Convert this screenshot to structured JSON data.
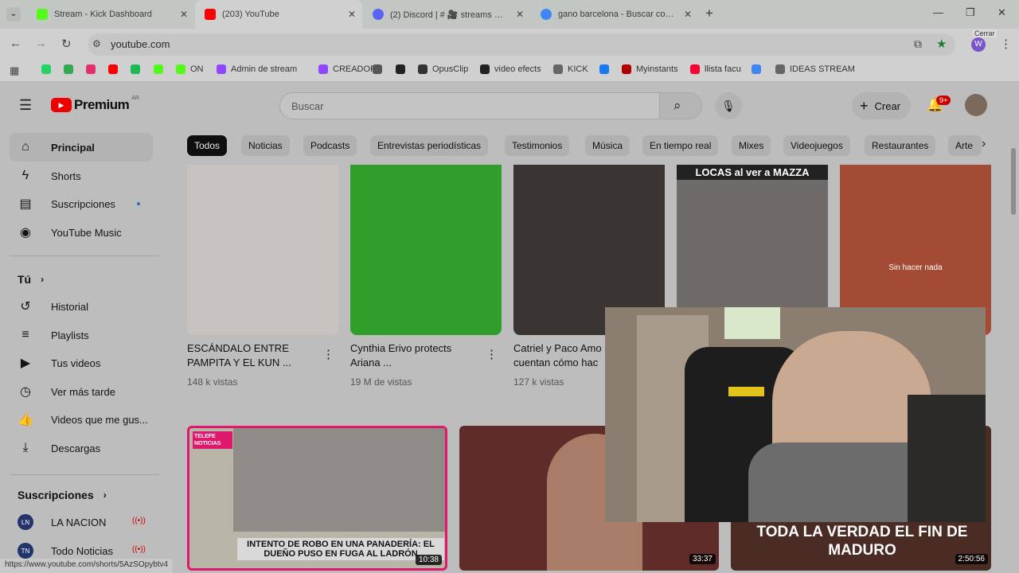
{
  "tabs": [
    {
      "title": "Stream - Kick Dashboard",
      "color": "#53fc18"
    },
    {
      "title": "(203) YouTube",
      "color": "#ff0000"
    },
    {
      "title": "(2) Discord | # 🎥 streams 🎥 | L",
      "color": "#5865f2"
    },
    {
      "title": "gano barcelona - Buscar con G",
      "color": "#4285f4"
    }
  ],
  "address": {
    "url": "youtube.com",
    "tooltip": "Cerrar"
  },
  "bookmarks": [
    {
      "label": "",
      "color": "#25d366"
    },
    {
      "label": "",
      "color": "#34a853"
    },
    {
      "label": "",
      "color": "#e1306c"
    },
    {
      "label": "",
      "color": "#ff0000"
    },
    {
      "label": "",
      "color": "#1db954"
    },
    {
      "label": "",
      "color": "#53fc18"
    },
    {
      "label": "ON",
      "color": "#53fc18"
    },
    {
      "label": "Admin de stream",
      "color": "#9146ff"
    },
    {
      "label": "CREADOR",
      "color": "#9146ff"
    },
    {
      "label": "",
      "color": "#555555"
    },
    {
      "label": "",
      "color": "#222222"
    },
    {
      "label": "OpusClip",
      "color": "#333333"
    },
    {
      "label": "video efects",
      "color": "#222222"
    },
    {
      "label": "KICK",
      "color": "#666666"
    },
    {
      "label": "",
      "color": "#1877f2"
    },
    {
      "label": "Myinstants",
      "color": "#b00000"
    },
    {
      "label": "llista facu",
      "color": "#ff0033"
    },
    {
      "label": "",
      "color": "#4285f4"
    },
    {
      "label": "IDEAS STREAM",
      "color": "#666666"
    }
  ],
  "header": {
    "logo": "Premium",
    "country": "AR",
    "search_placeholder": "Buscar",
    "create_label": "Crear",
    "notif_count": "9+"
  },
  "sidebar": {
    "main": [
      {
        "label": "Principal",
        "icon": "home-icon"
      },
      {
        "label": "Shorts",
        "icon": "shorts-icon"
      },
      {
        "label": "Suscripciones",
        "icon": "subscriptions-icon"
      },
      {
        "label": "YouTube Music",
        "icon": "music-icon"
      }
    ],
    "you_header": "Tú",
    "you": [
      {
        "label": "Historial",
        "icon": "history-icon"
      },
      {
        "label": "Playlists",
        "icon": "playlists-icon"
      },
      {
        "label": "Tus videos",
        "icon": "your-videos-icon"
      },
      {
        "label": "Ver más tarde",
        "icon": "watch-later-icon"
      },
      {
        "label": "Videos que me gus...",
        "icon": "liked-icon"
      },
      {
        "label": "Descargas",
        "icon": "downloads-icon"
      }
    ],
    "subs_header": "Suscripciones",
    "subs": [
      {
        "label": "LA NACION",
        "avatar": "LN"
      },
      {
        "label": "Todo Noticias",
        "avatar": "TN"
      }
    ]
  },
  "chips": [
    "Todos",
    "Noticias",
    "Podcasts",
    "Entrevistas periodísticas",
    "Testimonios",
    "Música",
    "En tiempo real",
    "Mixes",
    "Videojuegos",
    "Restaurantes",
    "Arte"
  ],
  "shorts": [
    {
      "title": "ESCÁNDALO ENTRE PAMPITA Y EL KUN ...",
      "views": "148 k vistas",
      "bg": "#c8c3c0"
    },
    {
      "title": "Cynthia Erivo protects Ariana ...",
      "views": "19 M de vistas",
      "bg": "#2f9e2a"
    },
    {
      "title": "Catriel y Paco Amo cuentan cómo hac",
      "views": "127 k vistas",
      "bg": "#3a3432"
    },
    {
      "title": "",
      "views": "",
      "bg": "#6e6a68",
      "overlay": "LOCAS al ver a MAZZA"
    },
    {
      "title": "",
      "views": "",
      "bg": "#a44b36",
      "overlay": "Sin hacer nada"
    }
  ],
  "videos": [
    {
      "overlay": "INTENTO DE ROBO EN UNA PANADERÍA: EL DUEÑO PUSO EN FUGA AL LADRÓN",
      "badge": "TELEFE NOTICIAS",
      "duration": "10:38"
    },
    {
      "overlay": "",
      "duration": "33:37"
    },
    {
      "overlay": "TODA LA VERDAD EL FIN DE MADURO",
      "duration": "2:50:56"
    }
  ],
  "status_url": "https://www.youtube.com/shorts/5AzSOpybtv4"
}
